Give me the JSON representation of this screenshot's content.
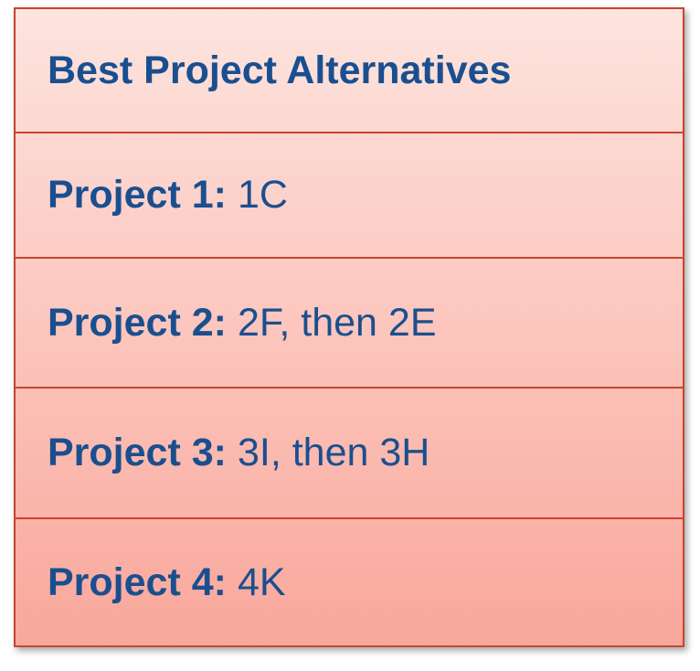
{
  "table": {
    "header": "Best Project Alternatives",
    "rows": [
      {
        "label": "Project 1:",
        "value": "1C"
      },
      {
        "label": "Project 2:",
        "value": "2F, then 2E"
      },
      {
        "label": "Project 3:",
        "value": "3I, then 3H"
      },
      {
        "label": "Project 4:",
        "value": "4K"
      }
    ]
  },
  "colors": {
    "border": "#c8442f",
    "text": "#1a4f8f",
    "fill_top": "#fde4df",
    "fill_bottom": "#f9a79b"
  }
}
